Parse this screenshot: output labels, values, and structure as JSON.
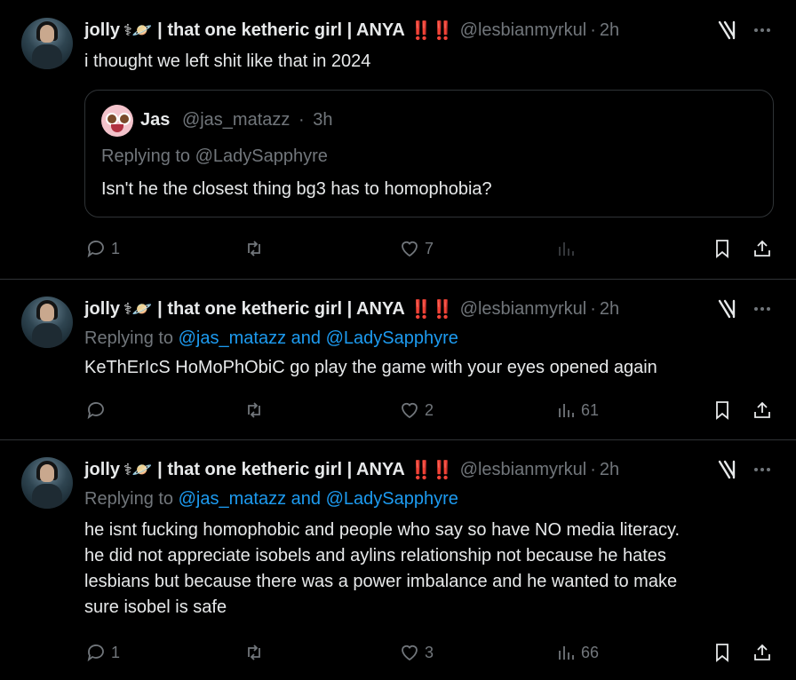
{
  "tweets": [
    {
      "author": {
        "name": "jolly",
        "emoji": "⚕🪐",
        "suffix": "| that one ketheric girl | ANYA",
        "bangs": "‼️‼️",
        "handle": "@lesbianmyrkul",
        "separator": "·",
        "time": "2h"
      },
      "text": "i thought we left shit like that in 2024",
      "quote": {
        "name": "Jas",
        "handle": "@jas_matazz",
        "separator": "·",
        "time": "3h",
        "replying_prefix": "Replying to",
        "replying_to": "@LadySapphyre",
        "text": "Isn't he the closest thing bg3 has to homophobia?"
      },
      "actions": {
        "replies": "1",
        "reposts": "",
        "likes": "7",
        "views": ""
      }
    },
    {
      "author": {
        "name": "jolly",
        "emoji": "⚕🪐",
        "suffix": "| that one ketheric girl | ANYA",
        "bangs": "‼️‼️",
        "handle": "@lesbianmyrkul",
        "separator": "·",
        "time": "2h"
      },
      "replying_prefix": "Replying to",
      "replying_to": "@jas_matazz and @LadySapphyre",
      "text": "KeThErIcS HoMoPhObiC go play the game with your eyes opened again",
      "actions": {
        "replies": "",
        "reposts": "",
        "likes": "2",
        "views": "61"
      }
    },
    {
      "author": {
        "name": "jolly",
        "emoji": "⚕🪐",
        "suffix": "| that one ketheric girl | ANYA",
        "bangs": "‼️‼️",
        "handle": "@lesbianmyrkul",
        "separator": "·",
        "time": "2h"
      },
      "replying_prefix": "Replying to",
      "replying_to": "@jas_matazz and @LadySapphyre",
      "text_lines": [
        "he isnt fucking homophobic and people who say so have NO media literacy.",
        "he did not appreciate isobels and aylins relationship not because he hates",
        "lesbians but because there was a power imbalance and he wanted to make",
        "sure isobel is safe"
      ],
      "actions": {
        "replies": "1",
        "reposts": "",
        "likes": "3",
        "views": "66"
      }
    }
  ],
  "icons": {
    "reply": "reply-icon",
    "repost": "repost-icon",
    "like": "heart-icon",
    "views": "views-icon",
    "bookmark": "bookmark-icon",
    "share": "share-icon",
    "grok": "grok-icon",
    "more": "more-icon"
  },
  "colors": {
    "background": "#000000",
    "text": "#e7e9ea",
    "muted": "#71767b",
    "link": "#1d9bf0",
    "divider": "#2f3336",
    "bangs": "#e0245e"
  }
}
